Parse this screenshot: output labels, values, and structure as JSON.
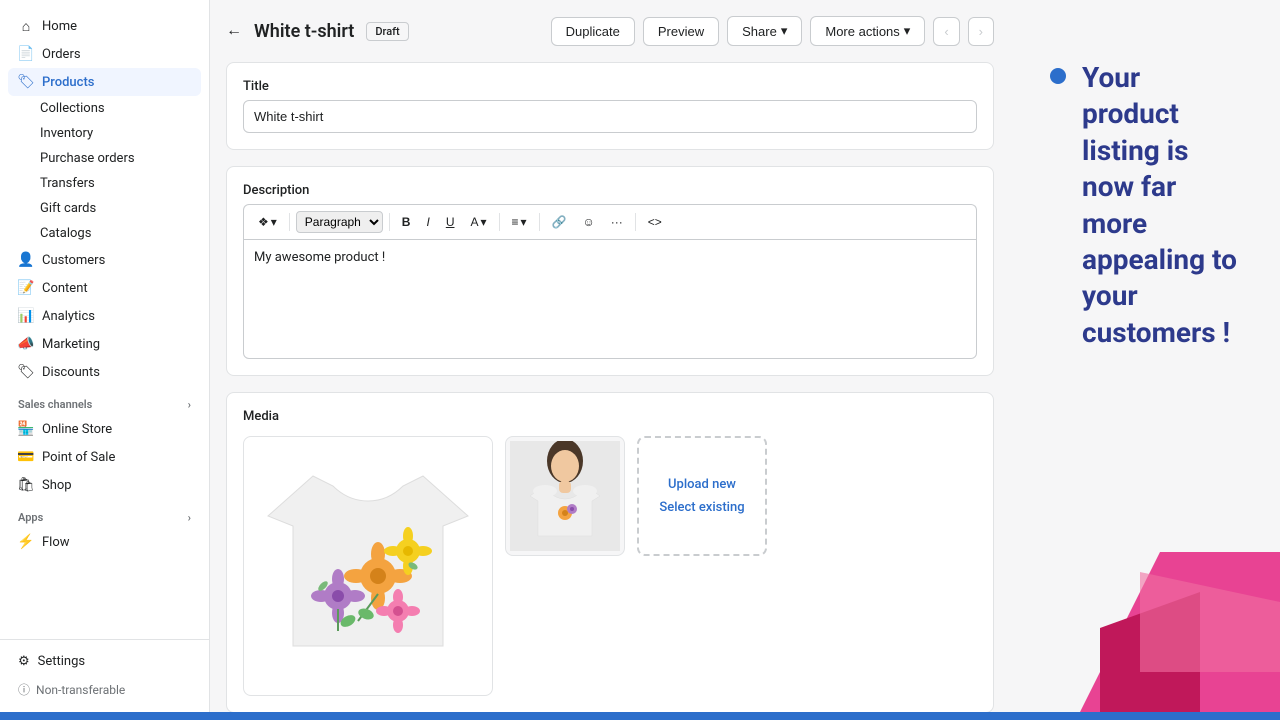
{
  "sidebar": {
    "home": "Home",
    "orders": "Orders",
    "products": "Products",
    "sub_collections": "Collections",
    "sub_inventory": "Inventory",
    "sub_purchase_orders": "Purchase orders",
    "sub_transfers": "Transfers",
    "sub_gift_cards": "Gift cards",
    "sub_catalogs": "Catalogs",
    "customers": "Customers",
    "content": "Content",
    "analytics": "Analytics",
    "marketing": "Marketing",
    "discounts": "Discounts",
    "sales_channels_label": "Sales channels",
    "online_store": "Online Store",
    "point_of_sale": "Point of Sale",
    "shop": "Shop",
    "apps_label": "Apps",
    "flow": "Flow",
    "settings": "Settings",
    "non_transferable": "Non-transferable"
  },
  "header": {
    "back_label": "←",
    "product_name": "White t-shirt",
    "status": "Draft",
    "btn_duplicate": "Duplicate",
    "btn_preview": "Preview",
    "btn_share": "Share",
    "btn_more": "More actions",
    "btn_prev": "‹",
    "btn_next": "›"
  },
  "product_form": {
    "title_label": "Title",
    "title_value": "White t-shirt",
    "desc_label": "Description",
    "desc_placeholder": "Paragraph",
    "desc_content": "My awesome product !",
    "media_label": "Media",
    "upload_new": "Upload new",
    "select_existing": "Select existing"
  },
  "right_panel": {
    "bullet_text": "Your product listing is now far more appealing to your customers !"
  },
  "toolbar": {
    "format_btn": "❖",
    "paragraph_label": "Paragraph",
    "bold": "B",
    "italic": "I",
    "underline": "U",
    "color": "A",
    "align": "≡",
    "link": "🔗",
    "emoji": "☺",
    "more": "···",
    "code": "<>"
  }
}
